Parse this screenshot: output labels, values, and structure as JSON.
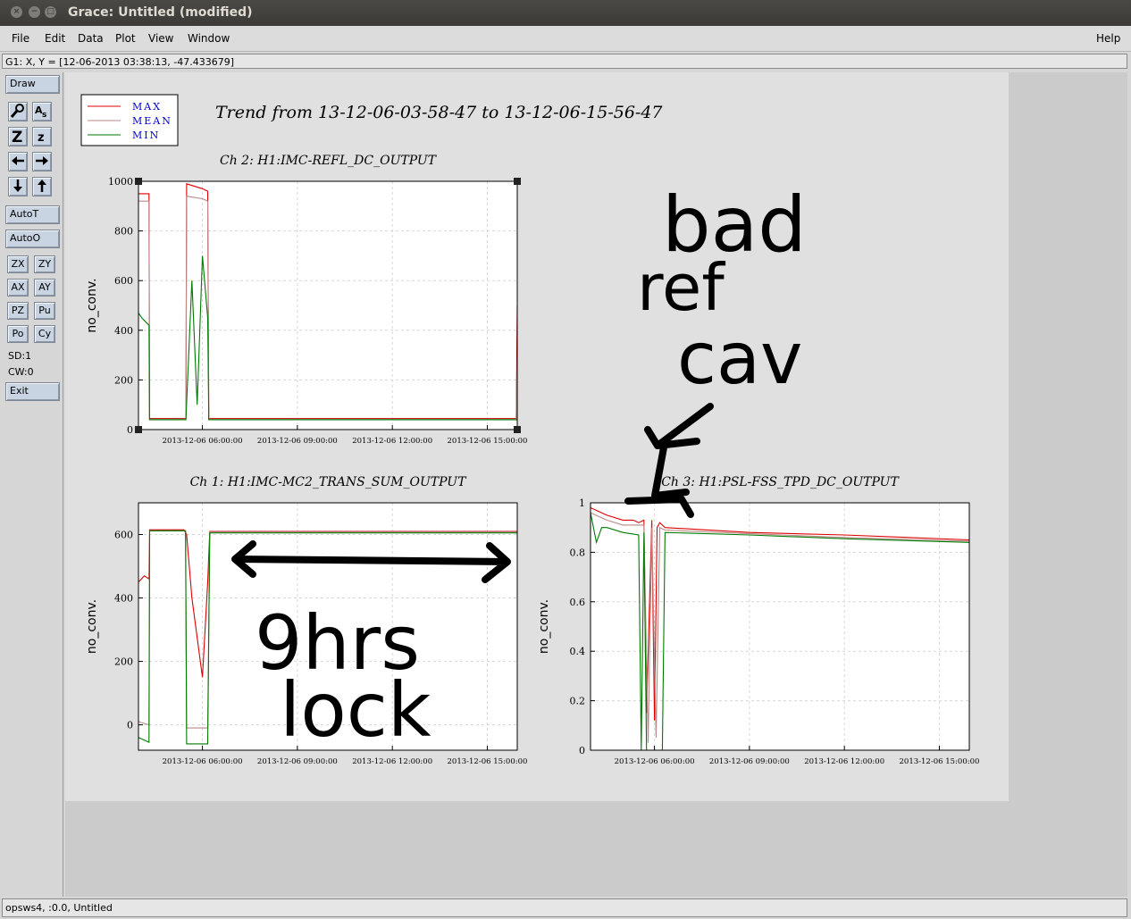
{
  "window": {
    "title": "Grace: Untitled (modified)",
    "buttons": {
      "close": "×",
      "minimize": "−",
      "maximize": "□"
    }
  },
  "menu": {
    "items": [
      "File",
      "Edit",
      "Data",
      "Plot",
      "View",
      "Window"
    ],
    "help": "Help"
  },
  "locator": "G1: X, Y = [12-06-2013 03:38:13, -47.433679]",
  "toolbar": {
    "draw": "Draw",
    "icon_buttons": [
      "magnifier-icon",
      "text-aa-icon",
      "zoom-in-z-icon",
      "zoom-out-z-icon",
      "arrow-left-icon",
      "arrow-right-icon",
      "arrow-down-icon",
      "arrow-up-icon"
    ],
    "autot": "AutoT",
    "autoo": "AutoO",
    "small": [
      "ZX",
      "ZY",
      "AX",
      "AY",
      "PZ",
      "Pu",
      "Po",
      "Cy"
    ],
    "sd": "SD:1",
    "cw": "CW:0",
    "exit": "Exit"
  },
  "status": "opsws4, :0.0, Untitled",
  "plot": {
    "main_title": "Trend from 13-12-06-03-58-47 to 13-12-06-15-56-47",
    "legend": [
      {
        "label": "MAX",
        "color": "#dd0000"
      },
      {
        "label": "MEAN",
        "color": "#b88a8a"
      },
      {
        "label": "MIN",
        "color": "#007a00"
      }
    ],
    "annotations": {
      "bad": "bad",
      "ref": "ref",
      "cav": "cav",
      "hrs": "9hrs",
      "lock": "lock"
    }
  },
  "chart_data": [
    {
      "type": "line",
      "title": "Ch 2: H1:IMC-REFL_DC_OUTPUT",
      "ylabel": "no_conv.",
      "xlim": [
        "2013-12-06 03:58:47",
        "2013-12-06 15:56:47"
      ],
      "ylim": [
        0,
        1000
      ],
      "yticks": [
        0,
        200,
        400,
        600,
        800,
        1000
      ],
      "xticks": [
        "2013-12-06 06:00:00",
        "2013-12-06 09:00:00",
        "2013-12-06 12:00:00",
        "2013-12-06 15:00:00"
      ],
      "grid": true,
      "series": [
        {
          "name": "MAX",
          "color": "#dd0000",
          "x": [
            "2013-12-06 03:58:47",
            "2013-12-06 04:18:47",
            "2013-12-06 04:19:47",
            "2013-12-06 05:28:47",
            "2013-12-06 05:30:00",
            "2013-12-06 06:00:00",
            "2013-12-06 06:10:00",
            "2013-12-06 06:12:00",
            "2013-12-06 15:55:00",
            "2013-12-06 15:56:47"
          ],
          "values": [
            950,
            950,
            45,
            45,
            990,
            970,
            960,
            45,
            45,
            500
          ]
        },
        {
          "name": "MEAN",
          "color": "#b88a8a",
          "x": [
            "2013-12-06 03:58:47",
            "2013-12-06 04:18:47",
            "2013-12-06 04:19:47",
            "2013-12-06 05:28:47",
            "2013-12-06 05:30:00",
            "2013-12-06 06:00:00",
            "2013-12-06 06:10:00",
            "2013-12-06 06:12:00",
            "2013-12-06 15:55:00",
            "2013-12-06 15:56:47"
          ],
          "values": [
            920,
            920,
            42,
            42,
            940,
            930,
            920,
            42,
            42,
            300
          ]
        },
        {
          "name": "MIN",
          "color": "#007a00",
          "x": [
            "2013-12-06 03:58:47",
            "2013-12-06 04:05:00",
            "2013-12-06 04:18:47",
            "2013-12-06 04:19:47",
            "2013-12-06 05:28:47",
            "2013-12-06 05:40:00",
            "2013-12-06 05:50:00",
            "2013-12-06 06:00:00",
            "2013-12-06 06:10:00",
            "2013-12-06 06:12:00",
            "2013-12-06 15:56:47"
          ],
          "values": [
            470,
            450,
            420,
            40,
            40,
            600,
            100,
            700,
            450,
            40,
            40
          ]
        }
      ]
    },
    {
      "type": "line",
      "title": "Ch 1: H1:IMC-MC2_TRANS_SUM_OUTPUT",
      "ylabel": "no_conv.",
      "xlim": [
        "2013-12-06 03:58:47",
        "2013-12-06 15:56:47"
      ],
      "ylim": [
        -80,
        700
      ],
      "yticks": [
        0,
        200,
        400,
        600
      ],
      "xticks": [
        "2013-12-06 06:00:00",
        "2013-12-06 09:00:00",
        "2013-12-06 12:00:00",
        "2013-12-06 15:00:00"
      ],
      "grid": true,
      "series": [
        {
          "name": "MAX",
          "color": "#dd0000",
          "x": [
            "2013-12-06 03:58:47",
            "2013-12-06 04:10:00",
            "2013-12-06 04:18:47",
            "2013-12-06 04:20:00",
            "2013-12-06 05:25:00",
            "2013-12-06 05:30:00",
            "2013-12-06 05:40:00",
            "2013-12-06 06:00:00",
            "2013-12-06 06:10:00",
            "2013-12-06 06:14:00",
            "2013-12-06 15:56:47"
          ],
          "values": [
            450,
            470,
            460,
            615,
            615,
            600,
            400,
            150,
            450,
            610,
            610
          ]
        },
        {
          "name": "MEAN",
          "color": "#b88a8a",
          "x": [
            "2013-12-06 03:58:47",
            "2013-12-06 04:18:47",
            "2013-12-06 04:20:00",
            "2013-12-06 05:28:00",
            "2013-12-06 05:30:00",
            "2013-12-06 06:10:00",
            "2013-12-06 06:14:00",
            "2013-12-06 15:56:47"
          ],
          "values": [
            10,
            0,
            612,
            612,
            -10,
            -10,
            608,
            608
          ]
        },
        {
          "name": "MIN",
          "color": "#007a00",
          "x": [
            "2013-12-06 03:58:47",
            "2013-12-06 04:18:47",
            "2013-12-06 04:20:00",
            "2013-12-06 05:28:00",
            "2013-12-06 05:30:00",
            "2013-12-06 06:10:00",
            "2013-12-06 06:14:00",
            "2013-12-06 15:56:47"
          ],
          "values": [
            -40,
            -55,
            612,
            612,
            -60,
            -60,
            605,
            605
          ]
        }
      ]
    },
    {
      "type": "line",
      "title": "Ch 3: H1:PSL-FSS_TPD_DC_OUTPUT",
      "ylabel": "no_conv.",
      "xlim": [
        "2013-12-06 03:58:47",
        "2013-12-06 15:56:47"
      ],
      "ylim": [
        0,
        1
      ],
      "yticks": [
        0,
        0.2,
        0.4,
        0.6,
        0.8,
        1
      ],
      "xticks": [
        "2013-12-06 06:00:00",
        "2013-12-06 09:00:00",
        "2013-12-06 12:00:00",
        "2013-12-06 15:00:00"
      ],
      "grid": true,
      "series": [
        {
          "name": "MAX",
          "color": "#dd0000",
          "x": [
            "2013-12-06 03:58:47",
            "2013-12-06 04:30:00",
            "2013-12-06 05:00:00",
            "2013-12-06 05:20:00",
            "2013-12-06 05:30:00",
            "2013-12-06 05:40:00",
            "2013-12-06 05:45:00",
            "2013-12-06 05:55:00",
            "2013-12-06 06:00:00",
            "2013-12-06 06:05:00",
            "2013-12-06 06:10:00",
            "2013-12-06 06:20:00",
            "2013-12-06 09:00:00",
            "2013-12-06 12:00:00",
            "2013-12-06 15:56:47"
          ],
          "values": [
            0.98,
            0.95,
            0.93,
            0.93,
            0.92,
            0.93,
            0.15,
            0.93,
            0.12,
            0.9,
            0.92,
            0.9,
            0.88,
            0.87,
            0.85
          ]
        },
        {
          "name": "MEAN",
          "color": "#b88a8a",
          "x": [
            "2013-12-06 03:58:47",
            "2013-12-06 04:30:00",
            "2013-12-06 05:00:00",
            "2013-12-06 05:40:00",
            "2013-12-06 05:48:00",
            "2013-12-06 05:55:00",
            "2013-12-06 06:03:00",
            "2013-12-06 06:10:00",
            "2013-12-06 06:20:00",
            "2013-12-06 09:00:00",
            "2013-12-06 12:00:00",
            "2013-12-06 15:56:47"
          ],
          "values": [
            0.96,
            0.93,
            0.91,
            0.91,
            0.03,
            0.9,
            0.05,
            0.9,
            0.89,
            0.875,
            0.86,
            0.845
          ]
        },
        {
          "name": "MIN",
          "color": "#007a00",
          "x": [
            "2013-12-06 03:58:47",
            "2013-12-06 04:10:00",
            "2013-12-06 04:20:00",
            "2013-12-06 04:30:00",
            "2013-12-06 05:00:00",
            "2013-12-06 05:30:00",
            "2013-12-06 05:35:00",
            "2013-12-06 05:40:00",
            "2013-12-06 05:45:00",
            "2013-12-06 06:15:00",
            "2013-12-06 06:20:00",
            "2013-12-06 09:00:00",
            "2013-12-06 12:00:00",
            "2013-12-06 15:56:47"
          ],
          "values": [
            0.96,
            0.84,
            0.9,
            0.9,
            0.88,
            0.87,
            0.0,
            0.88,
            0.0,
            0.0,
            0.88,
            0.87,
            0.855,
            0.84
          ]
        }
      ]
    }
  ]
}
